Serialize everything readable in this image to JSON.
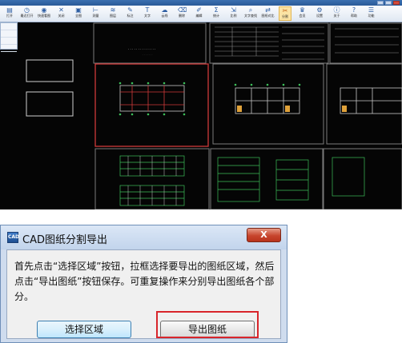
{
  "cad_window": {
    "toolbar": [
      {
        "label": "打开",
        "icon": "folder-icon"
      },
      {
        "label": "最近打开",
        "icon": "recent-icon"
      },
      {
        "label": "快速看图",
        "icon": "view-icon"
      },
      {
        "label": "关闭",
        "icon": "close-icon"
      },
      {
        "label": "全图",
        "icon": "fit-icon"
      },
      {
        "label": "测量",
        "icon": "measure-icon"
      },
      {
        "label": "图层",
        "icon": "layer-icon"
      },
      {
        "label": "标注",
        "icon": "annotate-icon"
      },
      {
        "label": "文字",
        "icon": "text-icon"
      },
      {
        "label": "云线",
        "icon": "cloud-icon"
      },
      {
        "label": "删除",
        "icon": "delete-icon"
      },
      {
        "label": "编辑",
        "icon": "edit-icon"
      },
      {
        "label": "统计",
        "icon": "stats-icon"
      },
      {
        "label": "比例",
        "icon": "scale-icon"
      },
      {
        "label": "文字查找",
        "icon": "find-icon"
      },
      {
        "label": "图纸对比",
        "icon": "compare-icon"
      },
      {
        "label": "分割",
        "icon": "split-icon"
      },
      {
        "label": "会员",
        "icon": "vip-icon"
      },
      {
        "label": "设置",
        "icon": "gear-icon"
      },
      {
        "label": "关于",
        "icon": "info-icon"
      },
      {
        "label": "帮助",
        "icon": "help-icon"
      },
      {
        "label": "功能",
        "icon": "feature-icon"
      }
    ]
  },
  "dialog": {
    "title": "CAD图纸分割导出",
    "close_label": "X",
    "app_icon_text": "CAD",
    "message": "首先点击“选择区域”按钮，拉框选择要导出的图纸区域，然后点击“导出图纸”按钮保存。可重复操作来分别导出图纸各个部分。",
    "select_button": "选择区域",
    "export_button": "导出图纸"
  },
  "colors": {
    "highlight": "#d8252b",
    "drawing_background": "#050505",
    "selection_frame": "#d03a3a"
  }
}
